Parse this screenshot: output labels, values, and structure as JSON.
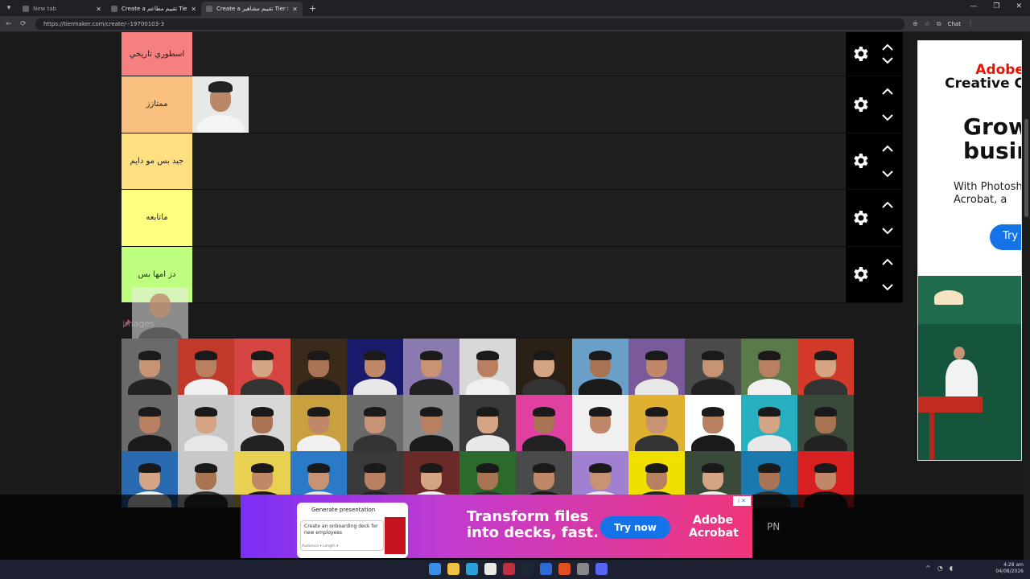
{
  "browser": {
    "tabs": [
      {
        "title": "New tab",
        "active": false
      },
      {
        "title": "Create a تقييم مطاعم Tier List - Tie",
        "active": false
      },
      {
        "title": "Create a تقييم مشاهير Tier List - Ti",
        "active": true
      }
    ],
    "new_tab_symbol": "+",
    "url": "https://tiermaker.com/create/--19700103-3",
    "chat_label": "Chat"
  },
  "tiers": [
    {
      "label": "اسطوري تاريخي",
      "color": "#f67f7f"
    },
    {
      "label": "ممتازز",
      "color": "#f9bf7f"
    },
    {
      "label": "جيد بس مو دايم",
      "color": "#ffdf7f"
    },
    {
      "label": "ماتابعه",
      "color": "#ffff7f"
    },
    {
      "label": "دز امها بس",
      "color": "#bfff7f"
    }
  ],
  "drag": {
    "hint": "images"
  },
  "right_ad": {
    "brand_line1": "Adobe",
    "brand_line2": "Creative C",
    "headline_line1": "Grow",
    "headline_line2": "busin",
    "sub_line1": "With Photosh",
    "sub_line2": "Acrobat, a",
    "cta": "Try"
  },
  "bottom_ad": {
    "card_title": "Generate presentation",
    "card_prompt": "Create an onboarding deck for new employees",
    "card_options": "Audience ▾  Length ▾",
    "headline_line1": "Transform files",
    "headline_line2": "into decks, fast.",
    "cta": "Try now",
    "brand_line1": "Adobe",
    "brand_line2": "Acrobat",
    "adchoices": "i ✕"
  },
  "side_text": "PN",
  "taskbar": {
    "time": "4:28 am",
    "date": "04/08/2026"
  },
  "grid_colors": [
    [
      "#6a6a6a",
      "#c0392b",
      "#d64541",
      "#3a2a1a",
      "#1a1a6a",
      "#8a7ab0",
      "#d8d8d8",
      "#2a2016",
      "#6aa0c8",
      "#7a5a9a",
      "#4a4a4a",
      "#5a7a4a",
      "#d33a2a"
    ],
    [
      "#6a6a6a",
      "#c8c8c8",
      "#d8d8d8",
      "#c8a040",
      "#6a6a6a",
      "#8a8a8a",
      "#3a3a3a",
      "#e040a0",
      "#f0f0f0",
      "#e0b030",
      "#ffffff",
      "#28b0c0",
      "#3a4a3a"
    ],
    [
      "#2a6ab0",
      "#c8c8c8",
      "#e8d050",
      "#2a7ac8",
      "#3a3a3a",
      "#6a2a2a",
      "#2a6a2a",
      "#4a4a4a",
      "#a080d0",
      "#f0e000",
      "#3a4a3a",
      "#1a7ab0",
      "#d82020"
    ]
  ]
}
